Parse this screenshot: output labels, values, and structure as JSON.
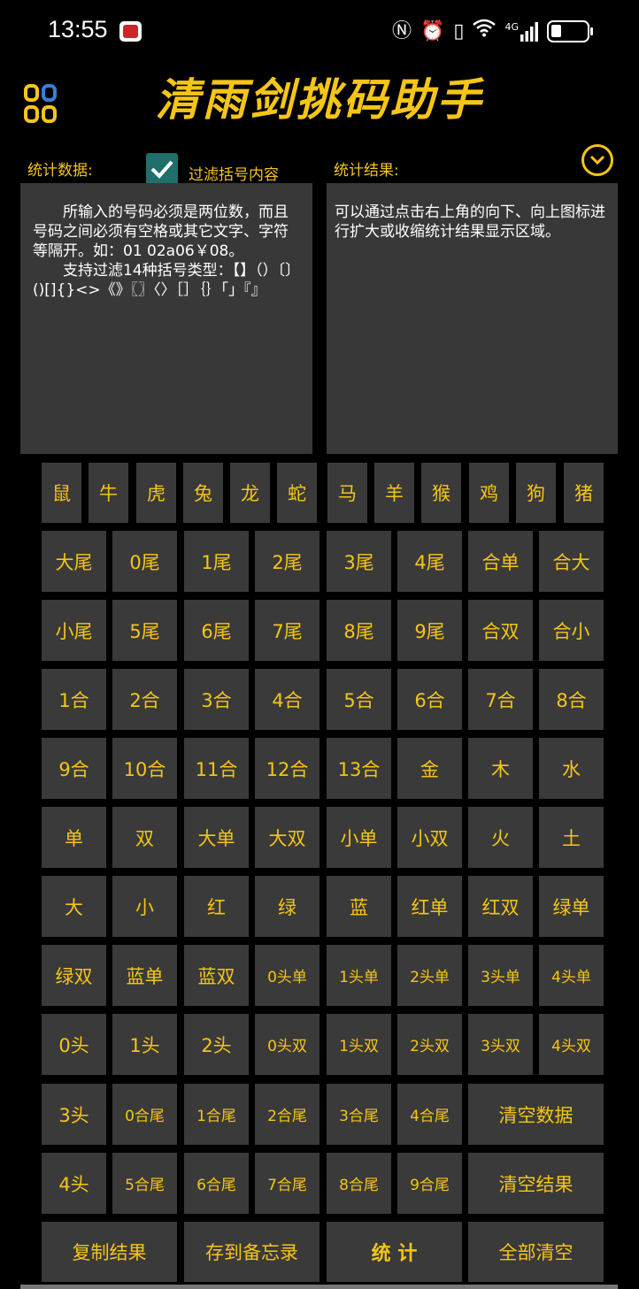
{
  "status_bar": {
    "time": "13:55",
    "icons": [
      "nfc-icon",
      "alarm-icon",
      "vibrate-icon",
      "wifi-icon",
      "signal-4g-icon",
      "battery-icon"
    ],
    "signal_label": "4G"
  },
  "header": {
    "title": "清雨剑挑码助手",
    "logo_icon": "app-logo-icon"
  },
  "stats_input": {
    "label": "统计数据:",
    "filter_label": "过滤括号内容",
    "filter_checked": true,
    "text": "　　所输入的号码必须是两位数，而且号码之间必须有空格或其它文字、字符等隔开。如：01 02a06￥08。\n　　支持过滤14种括号类型：【】（）〔〕()[]{}<>《》〖〗〈〉［］｛｝「」『』"
  },
  "stats_result": {
    "label": "统计结果:",
    "toggle_icon": "chevron-down-icon",
    "text": "可以通过点击右上角的向下、向上图标进行扩大或收缩统计结果显示区域。"
  },
  "zodiac_buttons": [
    "鼠",
    "牛",
    "虎",
    "兔",
    "龙",
    "蛇",
    "马",
    "羊",
    "猴",
    "鸡",
    "狗",
    "猪"
  ],
  "grid_rows": [
    [
      "大尾",
      "0尾",
      "1尾",
      "2尾",
      "3尾",
      "4尾",
      "合单",
      "合大"
    ],
    [
      "小尾",
      "5尾",
      "6尾",
      "7尾",
      "8尾",
      "9尾",
      "合双",
      "合小"
    ],
    [
      "1合",
      "2合",
      "3合",
      "4合",
      "5合",
      "6合",
      "7合",
      "8合"
    ],
    [
      "9合",
      "10合",
      "11合",
      "12合",
      "13合",
      "金",
      "木",
      "水"
    ],
    [
      "单",
      "双",
      "大单",
      "大双",
      "小单",
      "小双",
      "火",
      "土"
    ],
    [
      "大",
      "小",
      "红",
      "绿",
      "蓝",
      "红单",
      "红双",
      "绿单"
    ],
    [
      "绿双",
      "蓝单",
      "蓝双",
      "0头单",
      "1头单",
      "2头单",
      "3头单",
      "4头单"
    ],
    [
      "0头",
      "1头",
      "2头",
      "0头双",
      "1头双",
      "2头双",
      "3头双",
      "4头双"
    ]
  ],
  "row_tail_a": [
    "3头",
    "0合尾",
    "1合尾",
    "2合尾",
    "3合尾",
    "4合尾"
  ],
  "clear_data": "清空数据",
  "row_tail_b": [
    "4头",
    "5合尾",
    "6合尾",
    "7合尾",
    "8合尾",
    "9合尾"
  ],
  "clear_result": "清空结果",
  "bottom_actions": {
    "copy": "复制结果",
    "save": "存到备忘录",
    "stat": "统 计",
    "clear_all": "全部清空"
  },
  "colors": {
    "accent": "#F5C518",
    "button_bg": "#3a3a3a",
    "panel_bg": "#383838",
    "background": "#000000",
    "checkbox": "#1f6f6a"
  }
}
